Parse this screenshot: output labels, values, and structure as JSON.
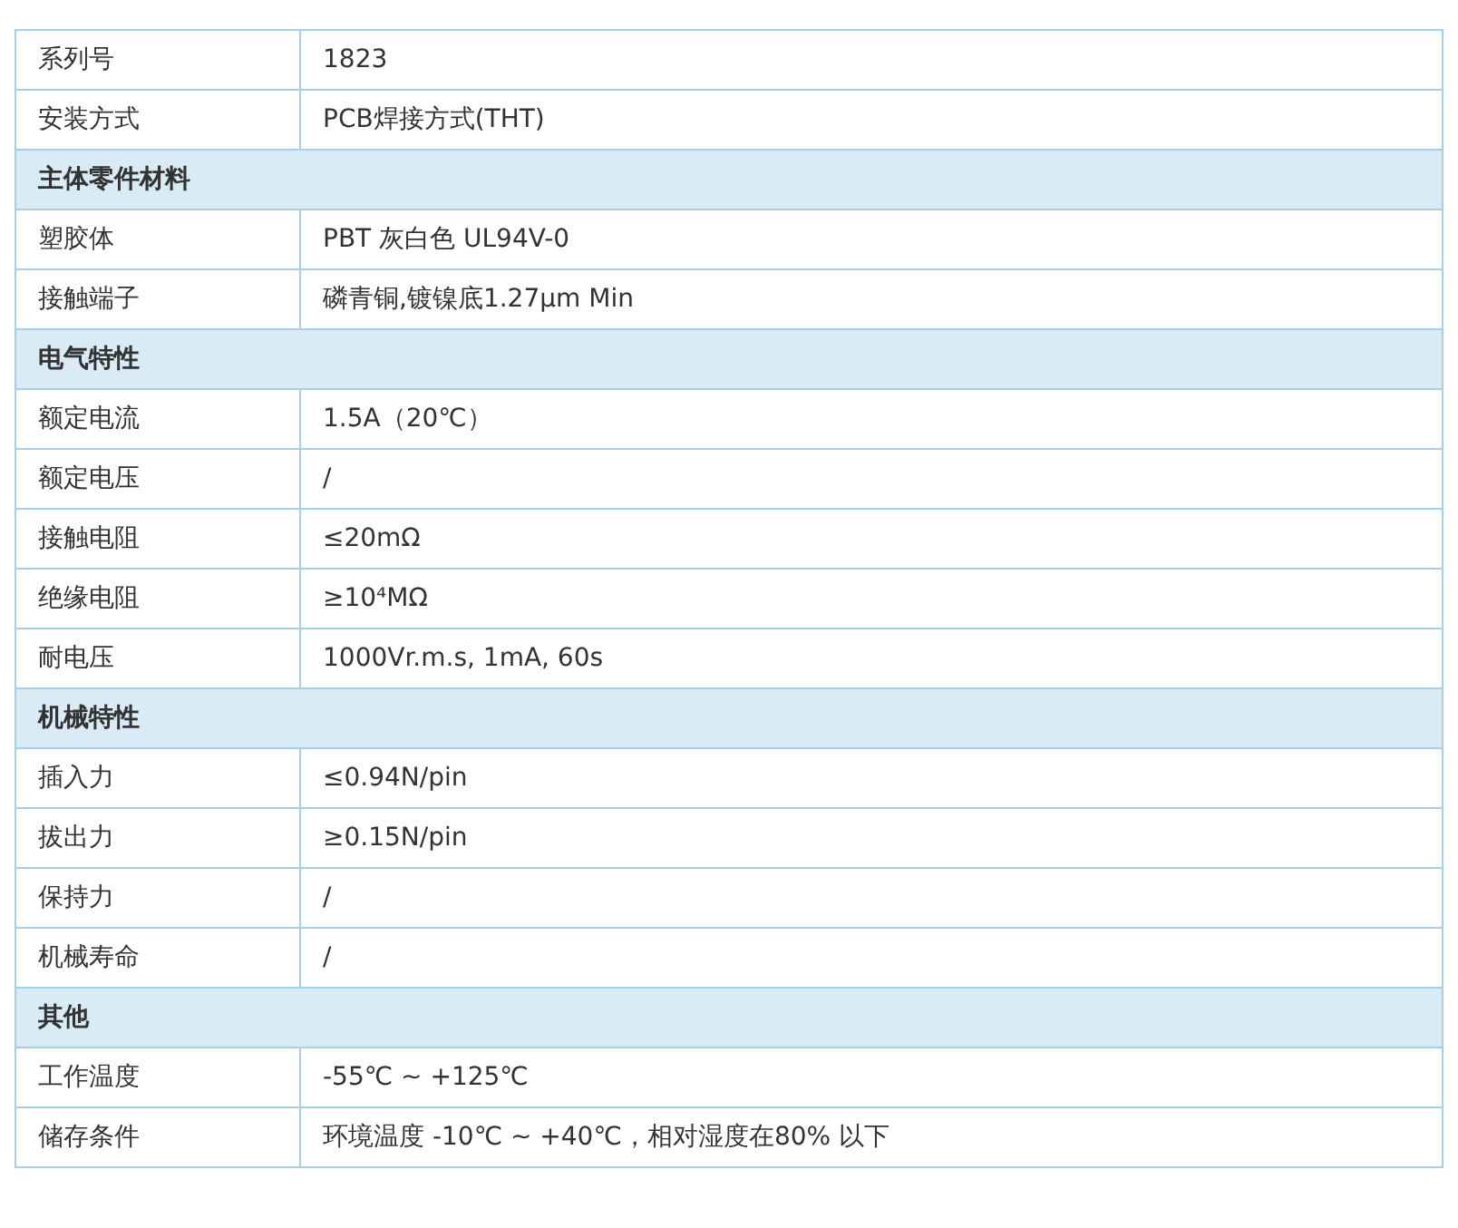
{
  "rows": [
    {
      "kind": "row",
      "label": "系列号",
      "value": "1823"
    },
    {
      "kind": "row",
      "label": "安装方式",
      "value": "PCB焊接方式(THT)"
    },
    {
      "kind": "section",
      "label": "主体零件材料"
    },
    {
      "kind": "row",
      "label": "塑胶体",
      "value": "PBT 灰白色 UL94V-0"
    },
    {
      "kind": "row",
      "label": "接触端子",
      "value": "磷青铜,镀镍底1.27μm Min"
    },
    {
      "kind": "section",
      "label": "电气特性"
    },
    {
      "kind": "row",
      "label": "额定电流",
      "value": "1.5A（20℃）"
    },
    {
      "kind": "row",
      "label": "额定电压",
      "value": "/"
    },
    {
      "kind": "row",
      "label": "接触电阻",
      "value": "≤20mΩ"
    },
    {
      "kind": "row",
      "label": "绝缘电阻",
      "value": "≥10⁴MΩ"
    },
    {
      "kind": "row",
      "label": "耐电压",
      "value": "1000Vr.m.s, 1mA, 60s"
    },
    {
      "kind": "section",
      "label": "机械特性"
    },
    {
      "kind": "row",
      "label": "插入力",
      "value": "≤0.94N/pin"
    },
    {
      "kind": "row",
      "label": "拔出力",
      "value": "≥0.15N/pin"
    },
    {
      "kind": "row",
      "label": "保持力",
      "value": "/"
    },
    {
      "kind": "row",
      "label": "机械寿命",
      "value": "/"
    },
    {
      "kind": "section",
      "label": "其他"
    },
    {
      "kind": "row",
      "label": "工作温度",
      "value": "-55℃ ~ +125℃"
    },
    {
      "kind": "row",
      "label": "储存条件",
      "value": "环境温度 -10℃ ~ +40℃，相对湿度在80% 以下"
    }
  ]
}
